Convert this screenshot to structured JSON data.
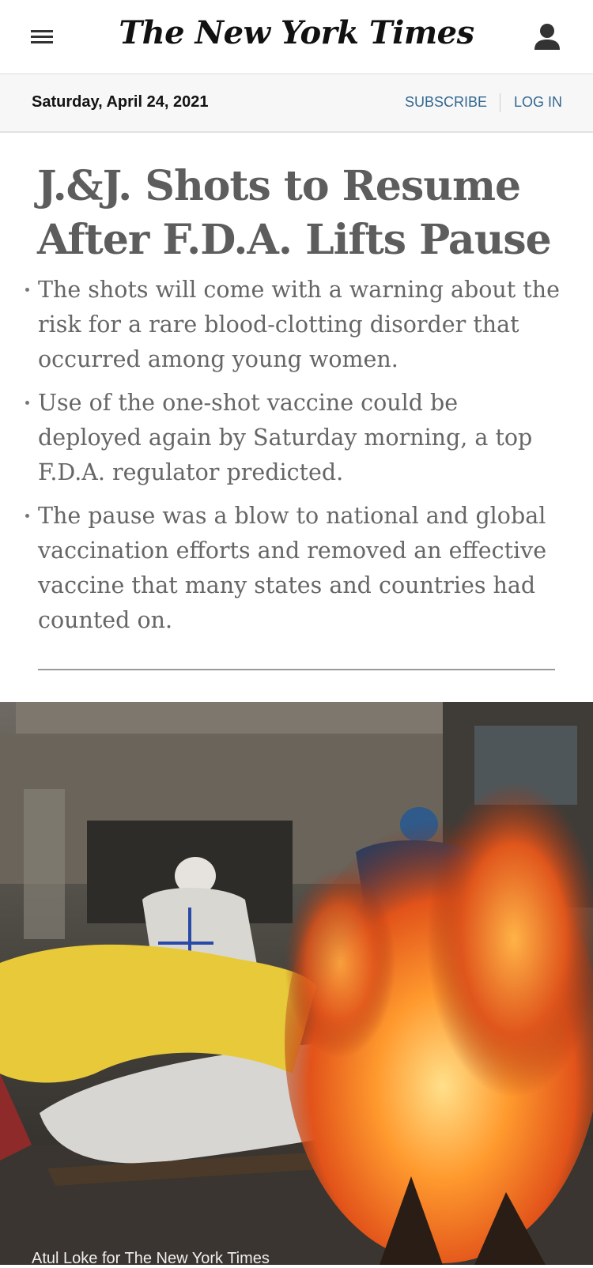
{
  "header": {
    "logo_text": "The New York Times",
    "menu_icon": "hamburger-menu-icon",
    "account_icon": "account-icon"
  },
  "datebar": {
    "date": "Saturday, April 24, 2021",
    "subscribe_label": "SUBSCRIBE",
    "login_label": "LOG IN"
  },
  "article": {
    "headline": "J.&J. Shots to Resume After F.D.A. Lifts Pause",
    "summary": [
      "The shots will come with a warning about the risk for a rare blood-clotting disorder that occurred among young women.",
      "Use of the one-shot vaccine could be deployed again by Saturday morning, a top F.D.A. regulator predicted.",
      "The pause was a blow to national and global vaccination efforts and removed an effective vaccine that many states and countries had counted on."
    ],
    "photo_credit": "Atul Loke for The New York Times"
  },
  "colors": {
    "link": "#326891",
    "headline": "#5d5d5d",
    "body": "#666666"
  }
}
